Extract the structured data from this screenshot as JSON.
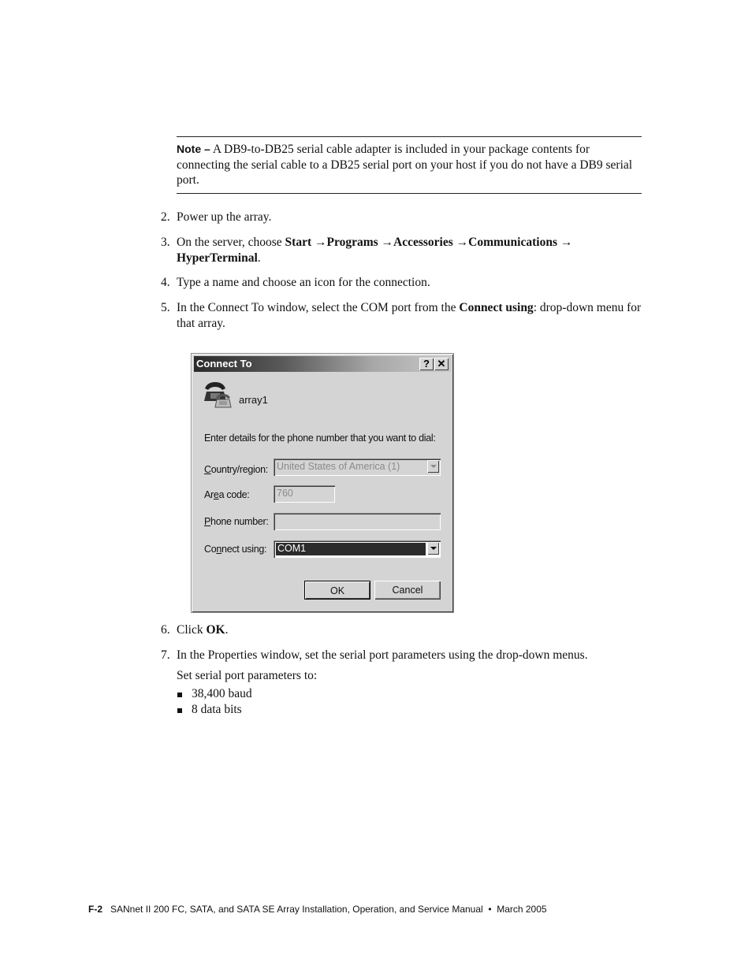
{
  "note": {
    "label": "Note –",
    "text": " A DB9-to-DB25 serial cable adapter is included in your package contents for connecting the serial cable to a DB25 serial port on your host if you do not have a DB9 serial port."
  },
  "steps": [
    {
      "num": "2.",
      "text": "Power up the array."
    },
    {
      "num": "3.",
      "prefix": "On the server, choose ",
      "path": [
        "Start",
        "Programs",
        "Accessories",
        "Communications",
        "HyperTerminal"
      ],
      "arrow": "→",
      "suffix": "."
    },
    {
      "num": "4.",
      "text": "Type a name and choose an icon for the connection."
    },
    {
      "num": "5.",
      "prefix": "In the Connect To window, select the COM port from the ",
      "bold": "Connect using",
      "suffix": ": drop-down menu for that array."
    },
    {
      "num": "6.",
      "prefix": "Click ",
      "bold": "OK",
      "suffix": "."
    },
    {
      "num": "7.",
      "text": "In the Properties window, set the serial port parameters using the drop-down menus.",
      "subtext": "Set serial port parameters to:"
    }
  ],
  "bullets": [
    "38,400 baud",
    "8 data bits"
  ],
  "dialog": {
    "title": "Connect To",
    "help_label": "?",
    "close_label": "✕",
    "connection_name": "array1",
    "instruction": "Enter details for the phone number that you want to dial:",
    "fields": {
      "country": {
        "label_u": "C",
        "label_rest": "ountry/region:",
        "value": "United States of America (1)"
      },
      "area": {
        "label_pre": "Ar",
        "label_u": "e",
        "label_rest": "a code:",
        "value": "760"
      },
      "phone": {
        "label_u": "P",
        "label_rest": "hone number:",
        "value": ""
      },
      "connect": {
        "label_pre": "Co",
        "label_u": "n",
        "label_rest": "nect using:",
        "value": "COM1"
      }
    },
    "ok_label": "OK",
    "cancel_label": "Cancel"
  },
  "footer": {
    "page": "F-2",
    "text": "SANnet II 200 FC, SATA, and SATA SE Array Installation, Operation, and Service Manual  •  March 2005"
  }
}
